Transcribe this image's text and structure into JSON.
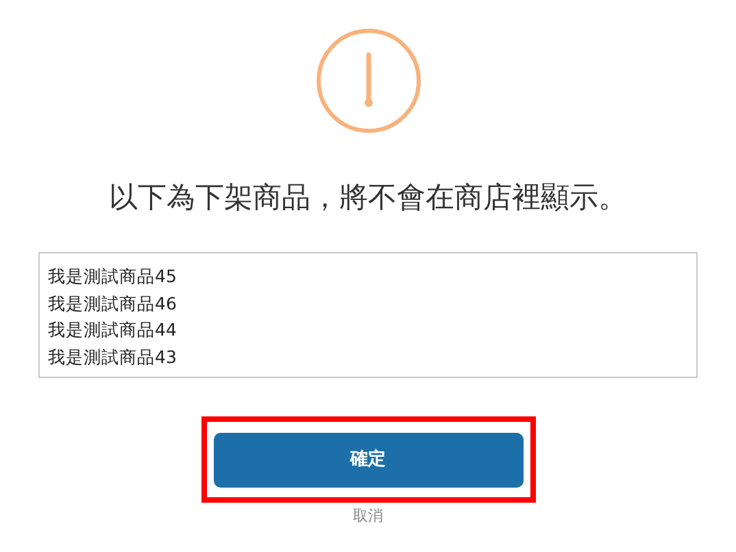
{
  "dialog": {
    "message": "以下為下架商品，將不會在商店裡顯示。",
    "items": [
      "我是測試商品45",
      "我是測試商品46",
      "我是測試商品44",
      "我是測試商品43"
    ],
    "confirm_button": {
      "label": "確定",
      "highlighted": true
    },
    "cancel_link": "取消"
  }
}
